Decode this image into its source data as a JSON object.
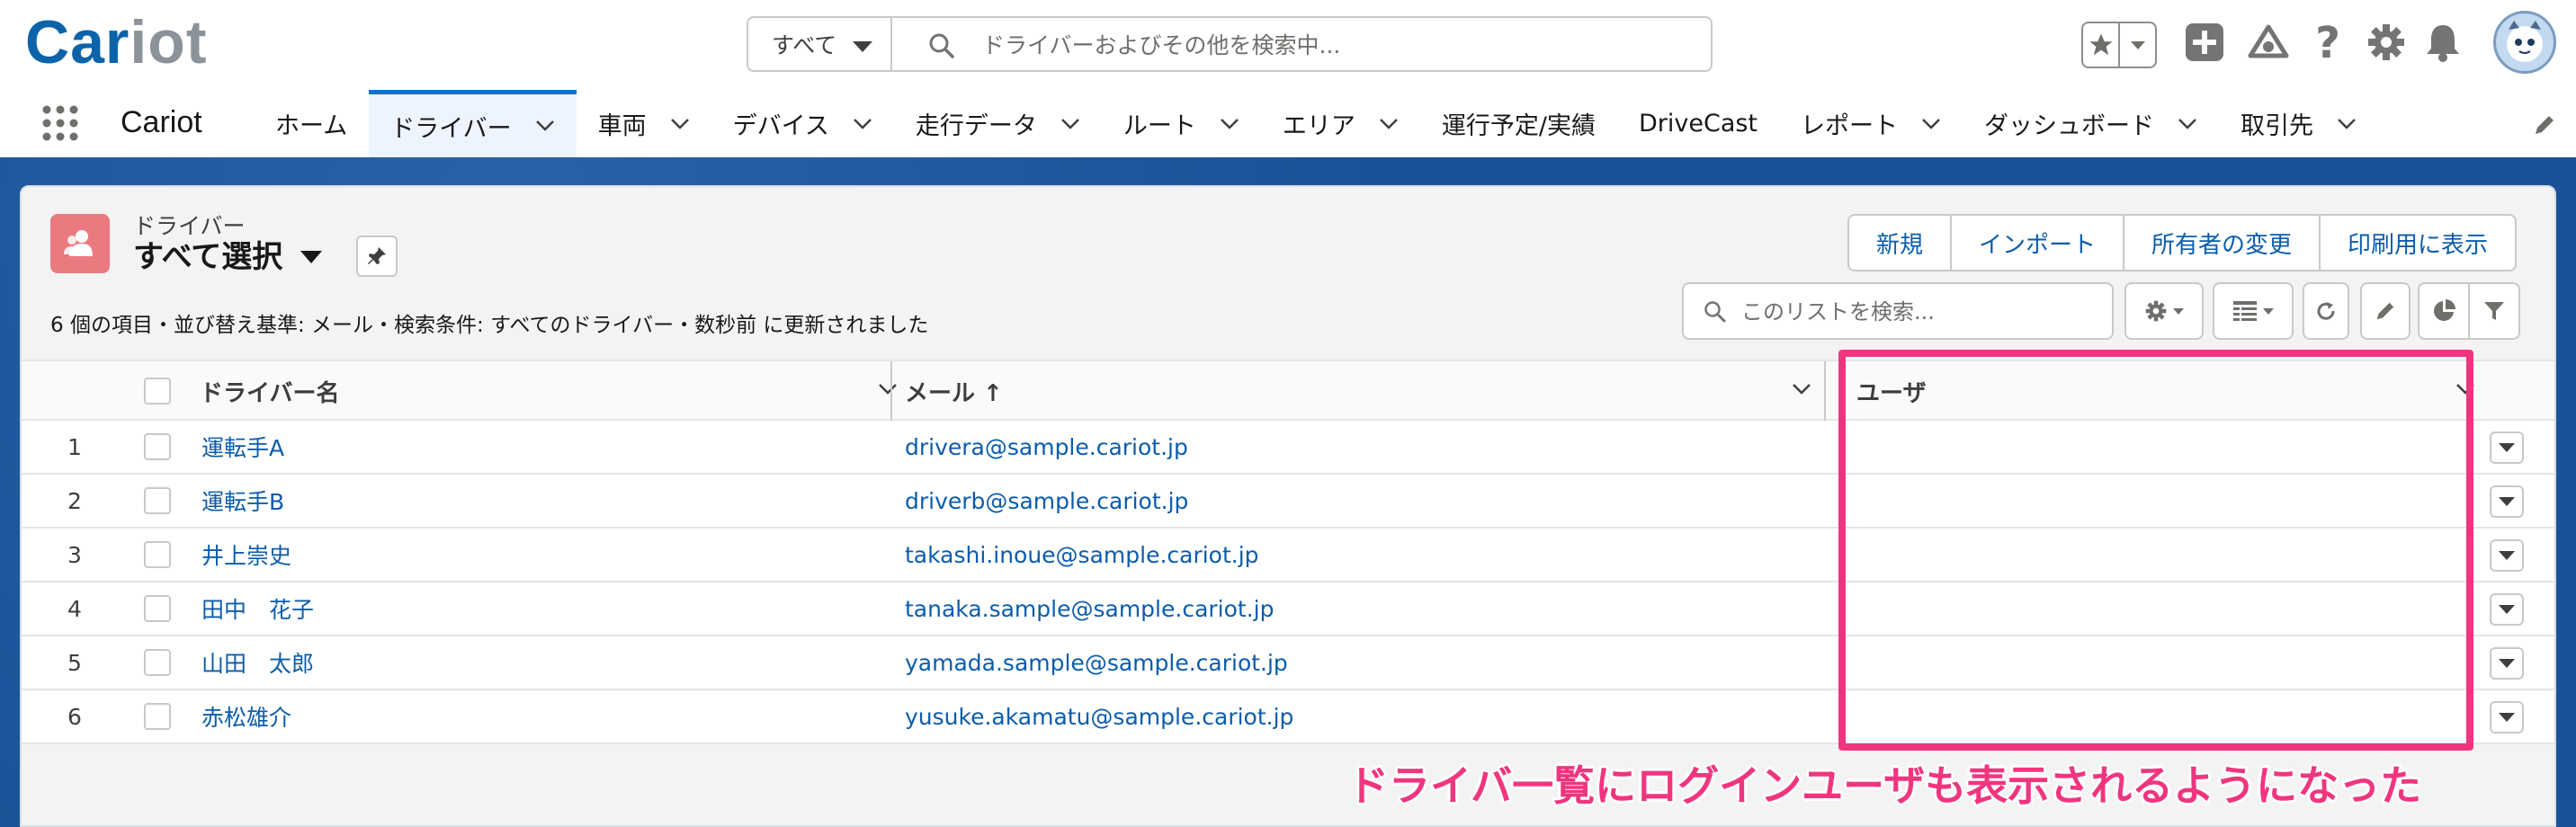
{
  "logo": {
    "text_a": "Car",
    "text_b": "iot"
  },
  "search": {
    "scope_label": "すべて",
    "placeholder": "ドライバーおよびその他を検索中..."
  },
  "header_icons": [
    "star-icon",
    "plus-icon",
    "trailhead-icon",
    "help-icon",
    "gear-icon",
    "bell-icon",
    "avatar"
  ],
  "nav": {
    "app_name": "Cariot",
    "items": [
      {
        "label": "ホーム",
        "has_menu": false
      },
      {
        "label": "ドライバー",
        "has_menu": true,
        "active": true
      },
      {
        "label": "車両",
        "has_menu": true
      },
      {
        "label": "デバイス",
        "has_menu": true
      },
      {
        "label": "走行データ",
        "has_menu": true
      },
      {
        "label": "ルート",
        "has_menu": true
      },
      {
        "label": "エリア",
        "has_menu": true
      },
      {
        "label": "運行予定/実績",
        "has_menu": false
      },
      {
        "label": "DriveCast",
        "has_menu": false
      },
      {
        "label": "レポート",
        "has_menu": true
      },
      {
        "label": "ダッシュボード",
        "has_menu": true
      },
      {
        "label": "取引先",
        "has_menu": true
      }
    ]
  },
  "list": {
    "object_label": "ドライバー",
    "view_name": "すべて選択",
    "info": "6 個の項目・並び替え基準: メール・検索条件: すべてのドライバー・数秒前 に更新されました",
    "actions": [
      "新規",
      "インポート",
      "所有者の変更",
      "印刷用に表示"
    ],
    "search_placeholder": "このリストを検索..."
  },
  "table": {
    "columns": {
      "name": "ドライバー名",
      "email": "メール ↑",
      "user": "ユーザ"
    },
    "rows": [
      {
        "num": "1",
        "name": "運転手A",
        "email": "drivera@sample.cariot.jp",
        "user": ""
      },
      {
        "num": "2",
        "name": "運転手B",
        "email": "driverb@sample.cariot.jp",
        "user": ""
      },
      {
        "num": "3",
        "name": "井上崇史",
        "email": "takashi.inoue@sample.cariot.jp",
        "user": ""
      },
      {
        "num": "4",
        "name": "田中　花子",
        "email": "tanaka.sample@sample.cariot.jp",
        "user": ""
      },
      {
        "num": "5",
        "name": "山田　太郎",
        "email": "yamada.sample@sample.cariot.jp",
        "user": ""
      },
      {
        "num": "6",
        "name": "赤松雄介",
        "email": "yusuke.akamatu@sample.cariot.jp",
        "user": ""
      }
    ]
  },
  "annotation": {
    "text": "ドライバ一覧にログインユーザも表示されるようになった",
    "color": "#f0357f"
  },
  "colors": {
    "brand": "#0b63a9",
    "link": "#0b5cab",
    "accent": "#0176d3",
    "object_icon": "#ea7a7f",
    "band": "#1b5297"
  }
}
